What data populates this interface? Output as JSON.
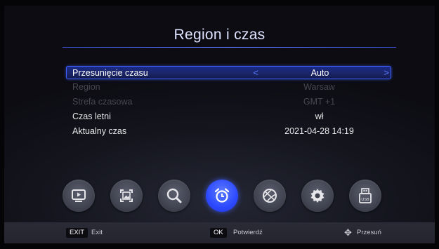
{
  "title": "Region i czas",
  "rows": [
    {
      "label": "Przesunięcie czasu",
      "value": "Auto"
    },
    {
      "label": "Region",
      "value": "Warsaw"
    },
    {
      "label": "Strefa czasowa",
      "value": "GMT +1"
    },
    {
      "label": "Czas letni",
      "value": "wł"
    },
    {
      "label": "Aktualny czas",
      "value": "2021-04-28 14:19"
    }
  ],
  "arrows": {
    "left": "<",
    "right": ">"
  },
  "menu_icons": [
    "tv-playback-icon",
    "picture-icon",
    "search-icon",
    "alarm-clock-icon",
    "globe-icon",
    "gear-icon",
    "usb-icon"
  ],
  "active_icon": "alarm-clock-icon",
  "footer": {
    "exit_key": "EXIT",
    "exit_label": "Exit",
    "ok_key": "OK",
    "ok_label": "Potwierdź",
    "move_label": "Przesuń"
  },
  "colors": {
    "accent": "#2c49ff",
    "title": "#dfe3ff"
  }
}
